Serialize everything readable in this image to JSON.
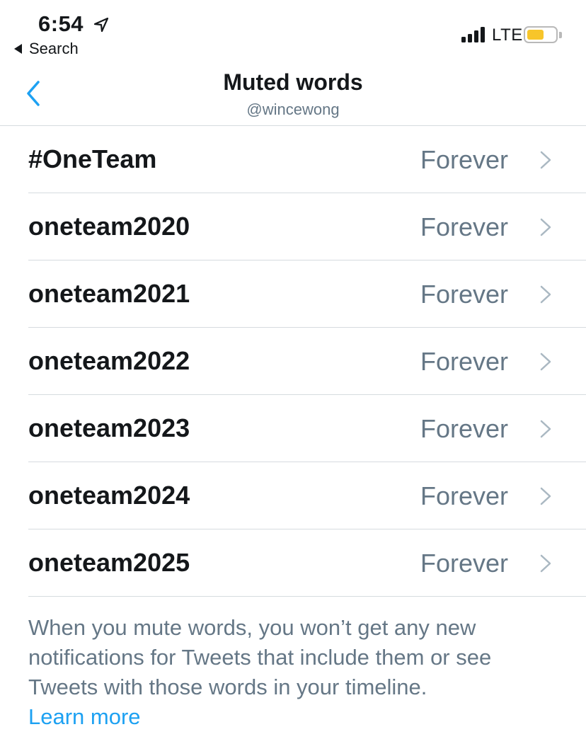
{
  "status_bar": {
    "time": "6:54",
    "back_app_label": "Search",
    "network": "LTE",
    "battery_color": "#f7c52a",
    "battery_level": 0.6
  },
  "nav": {
    "title": "Muted words",
    "subtitle": "@wincewong",
    "accent_color": "#1da1f2"
  },
  "muted_words": [
    {
      "word": "#OneTeam",
      "duration": "Forever"
    },
    {
      "word": "oneteam2020",
      "duration": "Forever"
    },
    {
      "word": "oneteam2021",
      "duration": "Forever"
    },
    {
      "word": "oneteam2022",
      "duration": "Forever"
    },
    {
      "word": "oneteam2023",
      "duration": "Forever"
    },
    {
      "word": "oneteam2024",
      "duration": "Forever"
    },
    {
      "word": "oneteam2025",
      "duration": "Forever"
    }
  ],
  "footer": {
    "note": "When you mute words, you won’t get any new notifications for Tweets that include them or see Tweets with those words in your timeline.",
    "learn_more": "Learn more"
  }
}
